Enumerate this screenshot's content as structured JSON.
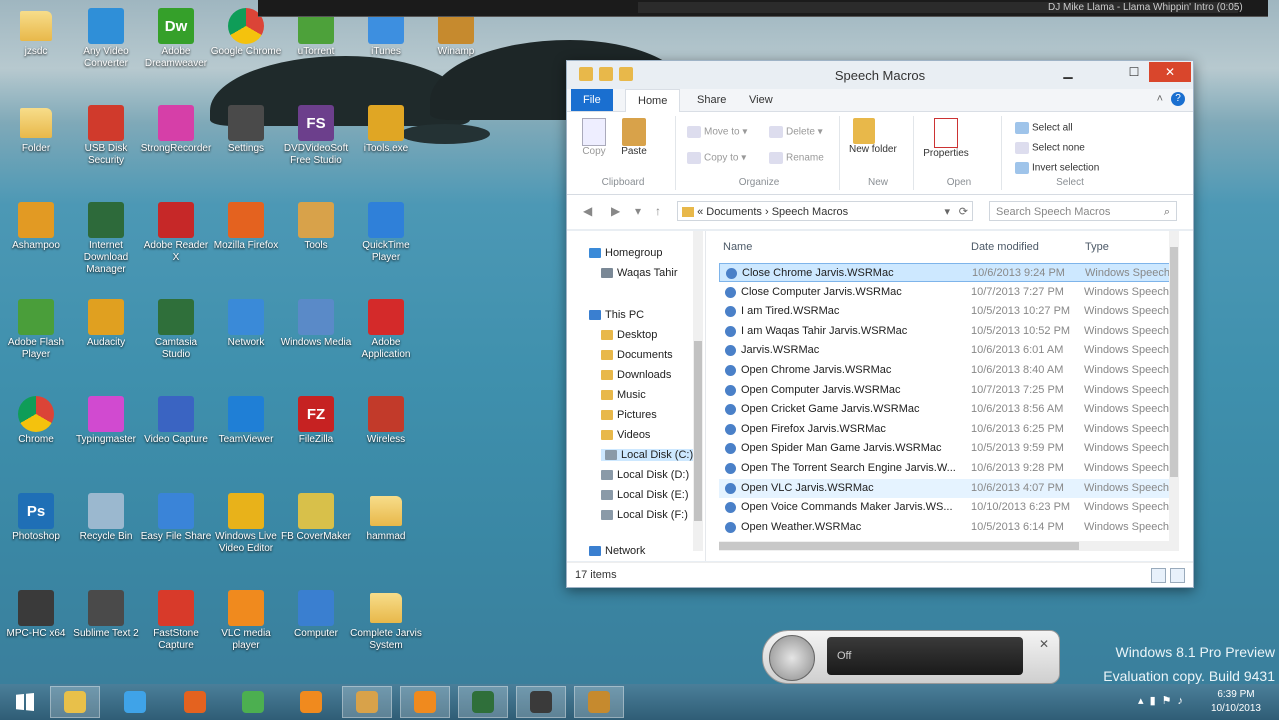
{
  "desktop": {
    "icons": [
      {
        "label": "jzsdc",
        "col": 0,
        "row": 0,
        "kind": "folder"
      },
      {
        "label": "Any Video Converter",
        "col": 1,
        "row": 0,
        "color": "#2f8fd8"
      },
      {
        "label": "Adobe Dreamweaver",
        "col": 2,
        "row": 0,
        "text": "Dw",
        "color": "#35a02a"
      },
      {
        "label": "Google Chrome",
        "col": 3,
        "row": 0,
        "kind": "chrome"
      },
      {
        "label": "uTorrent",
        "col": 4,
        "row": 0,
        "color": "#4da13a"
      },
      {
        "label": "iTunes",
        "col": 5,
        "row": 0,
        "color": "#3d8fe0"
      },
      {
        "label": "Winamp",
        "col": 6,
        "row": 0,
        "color": "#c68a2e"
      },
      {
        "label": "Folder",
        "col": 0,
        "row": 1,
        "kind": "folder"
      },
      {
        "label": "USB Disk Security",
        "col": 1,
        "row": 1,
        "color": "#d03a2c"
      },
      {
        "label": "StrongRecorder",
        "col": 2,
        "row": 1,
        "color": "#d63fa8"
      },
      {
        "label": "Settings",
        "col": 3,
        "row": 1,
        "color": "#4a4a4a"
      },
      {
        "label": "DVDVideoSoft Free Studio",
        "col": 4,
        "row": 1,
        "text": "FS",
        "color": "#6c3f8c"
      },
      {
        "label": "iTools.exe",
        "col": 5,
        "row": 1,
        "color": "#e0a624"
      },
      {
        "label": "Ashampoo",
        "col": 0,
        "row": 2,
        "color": "#e29a23"
      },
      {
        "label": "Internet Download Manager",
        "col": 1,
        "row": 2,
        "color": "#2d6a3a"
      },
      {
        "label": "Adobe Reader X",
        "col": 2,
        "row": 2,
        "color": "#c62828"
      },
      {
        "label": "Mozilla Firefox",
        "col": 3,
        "row": 2,
        "color": "#e4621f"
      },
      {
        "label": "Tools",
        "col": 4,
        "row": 2,
        "color": "#d8a24a"
      },
      {
        "label": "QuickTime Player",
        "col": 5,
        "row": 2,
        "color": "#2f80d9"
      },
      {
        "label": "Adobe Flash Player",
        "col": 0,
        "row": 3,
        "color": "#4a9e3a"
      },
      {
        "label": "Audacity",
        "col": 1,
        "row": 3,
        "color": "#e0a020"
      },
      {
        "label": "Camtasia Studio",
        "col": 2,
        "row": 3,
        "color": "#2f6f3a"
      },
      {
        "label": "Network",
        "col": 3,
        "row": 3,
        "color": "#3a8ad8"
      },
      {
        "label": "Windows Media",
        "col": 4,
        "row": 3,
        "color": "#5a8ac8"
      },
      {
        "label": "Adobe Application",
        "col": 5,
        "row": 3,
        "color": "#d42a2a"
      },
      {
        "label": "Chrome",
        "col": 0,
        "row": 4,
        "kind": "chrome"
      },
      {
        "label": "Typingmaster",
        "col": 1,
        "row": 4,
        "color": "#d14ad0"
      },
      {
        "label": "Video Capture",
        "col": 2,
        "row": 4,
        "color": "#3a64c2"
      },
      {
        "label": "TeamViewer",
        "col": 3,
        "row": 4,
        "color": "#1f7fd6"
      },
      {
        "label": "FileZilla",
        "col": 4,
        "row": 4,
        "text": "FZ",
        "color": "#c62222"
      },
      {
        "label": "Wireless",
        "col": 5,
        "row": 4,
        "color": "#c23a2a"
      },
      {
        "label": "Photoshop",
        "col": 0,
        "row": 5,
        "text": "Ps",
        "color": "#1f6fb6"
      },
      {
        "label": "Recycle Bin",
        "col": 1,
        "row": 5,
        "color": "#9bb8cf"
      },
      {
        "label": "Easy File Share",
        "col": 2,
        "row": 5,
        "color": "#3a84d8"
      },
      {
        "label": "Windows Live Video Editor",
        "col": 3,
        "row": 5,
        "color": "#e8b21a"
      },
      {
        "label": "FB CoverMaker",
        "col": 4,
        "row": 5,
        "color": "#d8c04a"
      },
      {
        "label": "hammad",
        "col": 5,
        "row": 5,
        "kind": "folder"
      },
      {
        "label": "MPC-HC x64",
        "col": 0,
        "row": 6,
        "color": "#3a3a3a"
      },
      {
        "label": "Sublime Text 2",
        "col": 1,
        "row": 6,
        "color": "#4a4a4a"
      },
      {
        "label": "FastStone Capture",
        "col": 2,
        "row": 6,
        "color": "#d83a2a"
      },
      {
        "label": "VLC media player",
        "col": 3,
        "row": 6,
        "color": "#f08a1e"
      },
      {
        "label": "Computer",
        "col": 4,
        "row": 6,
        "color": "#3a7fd0"
      },
      {
        "label": "Complete Jarvis System",
        "col": 5,
        "row": 6,
        "kind": "folder"
      }
    ]
  },
  "mediabar": {
    "now_playing": "DJ Mike Llama - Llama Whippin' Intro (0:05)"
  },
  "explorer": {
    "title": "Speech Macros",
    "tabs": [
      "File",
      "Home",
      "Share",
      "View"
    ],
    "ribbon": {
      "clipboard": {
        "name": "Clipboard",
        "copy": "Copy",
        "paste": "Paste"
      },
      "organize": {
        "name": "Organize",
        "move_to": "Move to",
        "copy_to": "Copy to",
        "delete": "Delete",
        "rename": "Rename"
      },
      "new": {
        "name": "New",
        "new_folder": "New folder"
      },
      "open": {
        "name": "Open",
        "properties": "Properties"
      },
      "select": {
        "name": "Select",
        "select_all": "Select all",
        "select_none": "Select none",
        "invert": "Invert selection"
      }
    },
    "address": {
      "path_1": "Documents",
      "path_2": "Speech Macros",
      "search_placeholder": "Search Speech Macros"
    },
    "nav": [
      {
        "label": "Homegroup",
        "indent": 0
      },
      {
        "label": "Waqas Tahir",
        "indent": 1
      },
      {
        "label": "This PC",
        "indent": 0
      },
      {
        "label": "Desktop",
        "indent": 1
      },
      {
        "label": "Documents",
        "indent": 1
      },
      {
        "label": "Downloads",
        "indent": 1
      },
      {
        "label": "Music",
        "indent": 1
      },
      {
        "label": "Pictures",
        "indent": 1
      },
      {
        "label": "Videos",
        "indent": 1
      },
      {
        "label": "Local Disk (C:)",
        "indent": 1
      },
      {
        "label": "Local Disk (D:)",
        "indent": 1
      },
      {
        "label": "Local Disk (E:)",
        "indent": 1
      },
      {
        "label": "Local Disk (F:)",
        "indent": 1
      },
      {
        "label": "Network",
        "indent": 0
      }
    ],
    "columns": {
      "name": "Name",
      "date": "Date modified",
      "type": "Type"
    },
    "files": [
      {
        "name": "Close Chrome Jarvis.WSRMac",
        "date": "10/6/2013 9:24 PM",
        "type": "Windows Speech..."
      },
      {
        "name": "Close Computer Jarvis.WSRMac",
        "date": "10/7/2013 7:27 PM",
        "type": "Windows Speech..."
      },
      {
        "name": "I am Tired.WSRMac",
        "date": "10/5/2013 10:27 PM",
        "type": "Windows Speech..."
      },
      {
        "name": "I am Waqas Tahir Jarvis.WSRMac",
        "date": "10/5/2013 10:52 PM",
        "type": "Windows Speech..."
      },
      {
        "name": "Jarvis.WSRMac",
        "date": "10/6/2013 6:01 AM",
        "type": "Windows Speech..."
      },
      {
        "name": "Open Chrome Jarvis.WSRMac",
        "date": "10/6/2013 8:40 AM",
        "type": "Windows Speech..."
      },
      {
        "name": "Open Computer Jarvis.WSRMac",
        "date": "10/7/2013 7:25 PM",
        "type": "Windows Speech..."
      },
      {
        "name": "Open Cricket Game Jarvis.WSRMac",
        "date": "10/6/2013 8:56 AM",
        "type": "Windows Speech..."
      },
      {
        "name": "Open Firefox Jarvis.WSRMac",
        "date": "10/6/2013 6:25 PM",
        "type": "Windows Speech..."
      },
      {
        "name": "Open Spider Man Game Jarvis.WSRMac",
        "date": "10/5/2013 9:59 PM",
        "type": "Windows Speech..."
      },
      {
        "name": "Open The Torrent Search Engine Jarvis.W...",
        "date": "10/6/2013 9:28 PM",
        "type": "Windows Speech..."
      },
      {
        "name": "Open VLC Jarvis.WSRMac",
        "date": "10/6/2013 4:07 PM",
        "type": "Windows Speech..."
      },
      {
        "name": "Open Voice Commands Maker Jarvis.WS...",
        "date": "10/10/2013 6:23 PM",
        "type": "Windows Speech..."
      },
      {
        "name": "Open Weather.WSRMac",
        "date": "10/5/2013 6:14 PM",
        "type": "Windows Speech..."
      }
    ],
    "selected_index": 0,
    "hover_index": 11,
    "status": "17 items"
  },
  "speech": {
    "state": "Off"
  },
  "watermark": {
    "line1": "Windows 8.1 Pro Preview",
    "line2": "Evaluation copy. Build 9431"
  },
  "taskbar": {
    "time": "6:39 PM",
    "date": "10/10/2013",
    "items": [
      {
        "name": "start-icon",
        "color": "#ffffff"
      },
      {
        "name": "file-explorer-icon",
        "color": "#e8c04a",
        "active": true
      },
      {
        "name": "internet-explorer-icon",
        "color": "#3fa3e8"
      },
      {
        "name": "firefox-icon",
        "color": "#e4621f"
      },
      {
        "name": "chrome-icon",
        "color": "#4caf50"
      },
      {
        "name": "media-player-icon",
        "color": "#f08a1e"
      },
      {
        "name": "tools-icon",
        "color": "#d8a24a",
        "active": true
      },
      {
        "name": "vlc-icon",
        "color": "#f08a1e",
        "active": true
      },
      {
        "name": "camtasia-icon",
        "color": "#2f6f3a",
        "active": true
      },
      {
        "name": "recorder-icon",
        "color": "#3a3a3a",
        "active": true
      },
      {
        "name": "winamp-icon",
        "color": "#c68a2e",
        "active": true
      }
    ]
  }
}
